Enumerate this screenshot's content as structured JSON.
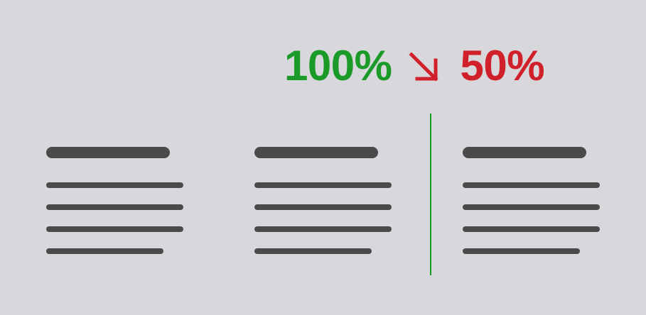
{
  "headline": {
    "from_value": "100%",
    "to_value": "50%",
    "arrow_icon": "arrow-down-right-icon",
    "from_color": "#1a9a27",
    "to_color": "#d0202a"
  },
  "colors": {
    "background": "#d8d7dc",
    "text_lines": "#4a4a4a",
    "divider": "#1a9a27"
  },
  "documents": [
    {
      "name": "document-1"
    },
    {
      "name": "document-2"
    },
    {
      "name": "document-3"
    }
  ]
}
